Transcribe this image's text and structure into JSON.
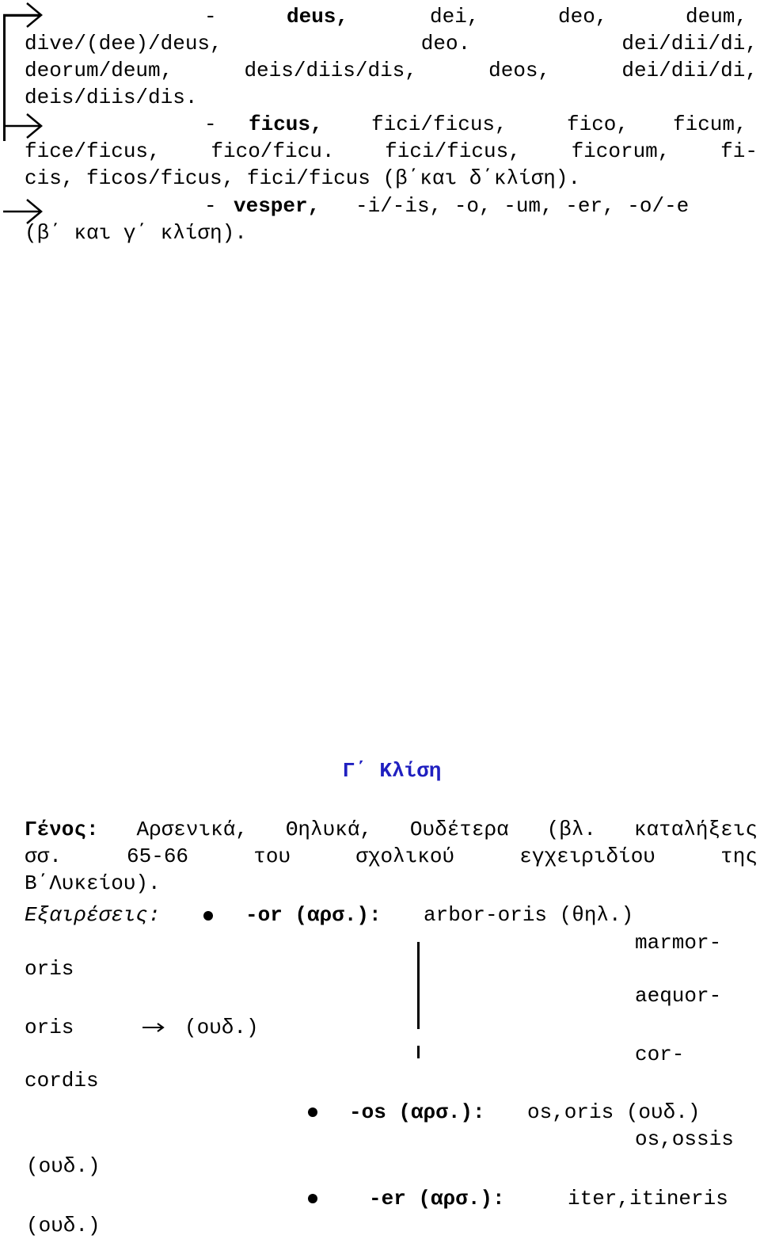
{
  "section1": {
    "deus": {
      "dash": "-",
      "head": "deus,",
      "forms_line1": [
        "dei,",
        "deo,",
        "deum,"
      ],
      "line2": [
        "dive/(dee)/deus,",
        "deo.",
        "dei/dii/di,"
      ],
      "line3": [
        "deorum/deum,",
        "deis/diis/dis,",
        "deos,",
        "dei/dii/di,"
      ],
      "line4": "deis/diis/dis."
    },
    "ficus": {
      "dash": "-",
      "head": "ficus,",
      "forms_line1": [
        "fici/ficus,",
        "fico,",
        "ficum,"
      ],
      "line2": [
        "fice/ficus,",
        "fico/ficu.",
        "fici/ficus,",
        "ficorum,",
        "fi-"
      ],
      "line3": "cis, ficos/ficus, fici/ficus (β΄και δ΄κλίση)."
    },
    "vesper": {
      "dash": "-",
      "head": "vesper,",
      "rest": "-i/-is, -o, -um, -er, -o/-e",
      "line2": "(β΄ και γ΄ κλίση)."
    }
  },
  "section2": {
    "heading": "Γ΄ Κλίση",
    "heading_color": "#2020c0",
    "genos_label": "Γένος:",
    "genos_line1": [
      "Αρσενικά,",
      "Θηλυκά,",
      "Ουδέτερα",
      "(βλ.",
      "καταλήξεις"
    ],
    "genos_line2": [
      "σσ.",
      "65-66",
      "του",
      "σχολικού",
      "εγχειριδίου",
      "της"
    ],
    "genos_line3": "Β΄Λυκείου).",
    "exceptions_label": "Εξαιρέσεις:",
    "or": {
      "ending": "-or (αρσ.):",
      "example": "arbor-oris (θηλ.)",
      "neuter_words": [
        "marmor-",
        "oris",
        "aequor-",
        "oris",
        "cor-",
        "cordis"
      ],
      "arrow_label": "(ουδ.)"
    },
    "os": {
      "ending": "-os (αρσ.):",
      "examples": [
        "os,oris (ουδ.)",
        "os,ossis",
        "(ουδ.)"
      ]
    },
    "er": {
      "ending": "-er (αρσ.):",
      "examples": [
        "iter,itineris",
        "(ουδ.)"
      ]
    }
  }
}
